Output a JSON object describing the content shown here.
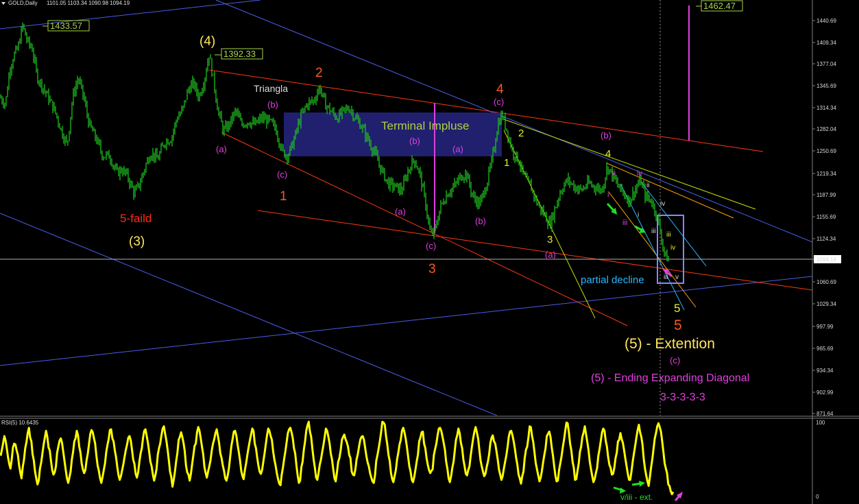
{
  "header": {
    "symbol": "GOLD,Daily",
    "ohlc": "1101.05 1103.34 1090.98 1094.19",
    "menu_icon": "triangle-down-icon"
  },
  "colors": {
    "background": "#000000",
    "candle": "#1fbf1f",
    "rsi": "#ffff00",
    "orange": "#ff5a1f",
    "yellow": "#ffe75a",
    "magenta": "#e040e0",
    "blue": "#4a5ee8",
    "cyan": "#2ab8ff",
    "green_arrow": "#22dd22",
    "box_blue": "#23237a",
    "price_box": "#a8d34a"
  },
  "chart_data": {
    "type": "candlestick",
    "title": "GOLD,Daily",
    "price_axis": {
      "ticks": [
        "1440.69",
        "1409.34",
        "1377.04",
        "1345.69",
        "1314.34",
        "1282.04",
        "1250.69",
        "1219.34",
        "1187.99",
        "1155.69",
        "1124.34",
        "1094.19",
        "1060.69",
        "1029.34",
        "997.99",
        "965.69",
        "934.34",
        "902.99",
        "871.64"
      ],
      "current": "1094.19",
      "ylim": [
        871.64,
        1462.47
      ]
    },
    "price_points": [
      {
        "x": 0,
        "y": 1330
      },
      {
        "x": 8,
        "y": 1320
      },
      {
        "x": 14,
        "y": 1370
      },
      {
        "x": 20,
        "y": 1390
      },
      {
        "x": 26,
        "y": 1400
      },
      {
        "x": 33,
        "y": 1433.57
      },
      {
        "x": 40,
        "y": 1410
      },
      {
        "x": 47,
        "y": 1400
      },
      {
        "x": 54,
        "y": 1360
      },
      {
        "x": 62,
        "y": 1345
      },
      {
        "x": 70,
        "y": 1330
      },
      {
        "x": 80,
        "y": 1310
      },
      {
        "x": 90,
        "y": 1280
      },
      {
        "x": 98,
        "y": 1260
      },
      {
        "x": 106,
        "y": 1330
      },
      {
        "x": 114,
        "y": 1358
      },
      {
        "x": 122,
        "y": 1330
      },
      {
        "x": 130,
        "y": 1290
      },
      {
        "x": 140,
        "y": 1270
      },
      {
        "x": 150,
        "y": 1245
      },
      {
        "x": 160,
        "y": 1245
      },
      {
        "x": 170,
        "y": 1220
      },
      {
        "x": 178,
        "y": 1225
      },
      {
        "x": 186,
        "y": 1215
      },
      {
        "x": 196,
        "y": 1190
      },
      {
        "x": 204,
        "y": 1205
      },
      {
        "x": 212,
        "y": 1230
      },
      {
        "x": 220,
        "y": 1250
      },
      {
        "x": 230,
        "y": 1240
      },
      {
        "x": 240,
        "y": 1265
      },
      {
        "x": 250,
        "y": 1270
      },
      {
        "x": 258,
        "y": 1300
      },
      {
        "x": 266,
        "y": 1310
      },
      {
        "x": 274,
        "y": 1340
      },
      {
        "x": 282,
        "y": 1350
      },
      {
        "x": 290,
        "y": 1330
      },
      {
        "x": 298,
        "y": 1355
      },
      {
        "x": 305,
        "y": 1392.33
      },
      {
        "x": 312,
        "y": 1350
      },
      {
        "x": 318,
        "y": 1310
      },
      {
        "x": 326,
        "y": 1280
      },
      {
        "x": 334,
        "y": 1290
      },
      {
        "x": 344,
        "y": 1310
      },
      {
        "x": 352,
        "y": 1290
      },
      {
        "x": 362,
        "y": 1295
      },
      {
        "x": 372,
        "y": 1290
      },
      {
        "x": 382,
        "y": 1300
      },
      {
        "x": 392,
        "y": 1295
      },
      {
        "x": 402,
        "y": 1285
      },
      {
        "x": 412,
        "y": 1250
      },
      {
        "x": 420,
        "y": 1245
      },
      {
        "x": 428,
        "y": 1265
      },
      {
        "x": 438,
        "y": 1300
      },
      {
        "x": 448,
        "y": 1320
      },
      {
        "x": 458,
        "y": 1325
      },
      {
        "x": 466,
        "y": 1345
      },
      {
        "x": 474,
        "y": 1320
      },
      {
        "x": 482,
        "y": 1310
      },
      {
        "x": 492,
        "y": 1300
      },
      {
        "x": 502,
        "y": 1310
      },
      {
        "x": 510,
        "y": 1315
      },
      {
        "x": 518,
        "y": 1300
      },
      {
        "x": 526,
        "y": 1290
      },
      {
        "x": 536,
        "y": 1270
      },
      {
        "x": 546,
        "y": 1250
      },
      {
        "x": 556,
        "y": 1225
      },
      {
        "x": 566,
        "y": 1205
      },
      {
        "x": 576,
        "y": 1200
      },
      {
        "x": 586,
        "y": 1195
      },
      {
        "x": 596,
        "y": 1225
      },
      {
        "x": 604,
        "y": 1240
      },
      {
        "x": 612,
        "y": 1220
      },
      {
        "x": 620,
        "y": 1180
      },
      {
        "x": 628,
        "y": 1130
      },
      {
        "x": 634,
        "y": 1135
      },
      {
        "x": 642,
        "y": 1170
      },
      {
        "x": 652,
        "y": 1190
      },
      {
        "x": 662,
        "y": 1200
      },
      {
        "x": 672,
        "y": 1215
      },
      {
        "x": 680,
        "y": 1220
      },
      {
        "x": 690,
        "y": 1185
      },
      {
        "x": 700,
        "y": 1175
      },
      {
        "x": 710,
        "y": 1205
      },
      {
        "x": 718,
        "y": 1240
      },
      {
        "x": 726,
        "y": 1290
      },
      {
        "x": 732,
        "y": 1305
      },
      {
        "x": 740,
        "y": 1280
      },
      {
        "x": 748,
        "y": 1250
      },
      {
        "x": 756,
        "y": 1240
      },
      {
        "x": 764,
        "y": 1215
      },
      {
        "x": 774,
        "y": 1200
      },
      {
        "x": 784,
        "y": 1175
      },
      {
        "x": 794,
        "y": 1160
      },
      {
        "x": 802,
        "y": 1145
      },
      {
        "x": 810,
        "y": 1170
      },
      {
        "x": 818,
        "y": 1195
      },
      {
        "x": 828,
        "y": 1210
      },
      {
        "x": 838,
        "y": 1200
      },
      {
        "x": 848,
        "y": 1195
      },
      {
        "x": 858,
        "y": 1205
      },
      {
        "x": 868,
        "y": 1200
      },
      {
        "x": 878,
        "y": 1195
      },
      {
        "x": 886,
        "y": 1230
      },
      {
        "x": 894,
        "y": 1215
      },
      {
        "x": 902,
        "y": 1200
      },
      {
        "x": 910,
        "y": 1190
      },
      {
        "x": 918,
        "y": 1180
      },
      {
        "x": 926,
        "y": 1195
      },
      {
        "x": 934,
        "y": 1210
      },
      {
        "x": 942,
        "y": 1185
      },
      {
        "x": 950,
        "y": 1180
      },
      {
        "x": 958,
        "y": 1160
      },
      {
        "x": 964,
        "y": 1130
      },
      {
        "x": 970,
        "y": 1100
      },
      {
        "x": 976,
        "y": 1094
      }
    ],
    "price_labels": [
      {
        "text": "1433.57",
        "x": 70,
        "y": 1433.57
      },
      {
        "text": "1392.33",
        "x": 325,
        "y": 1392.33
      },
      {
        "text": "1462.47",
        "x": 1023,
        "y": 1462.47
      }
    ],
    "rsi": {
      "label": "RSI(5) 10.6435",
      "ticks": [
        "100",
        "0"
      ],
      "ylim": [
        0,
        100
      ],
      "values": [
        54,
        62,
        71,
        80,
        74,
        63,
        52,
        43,
        37,
        49,
        65,
        70,
        69,
        61,
        55,
        41,
        32,
        24,
        39,
        49,
        64,
        72,
        84,
        91,
        78,
        73,
        56,
        48,
        33,
        24,
        16,
        21,
        37,
        45,
        57,
        69,
        78,
        87,
        79,
        65,
        61,
        47,
        35,
        29,
        32,
        40,
        58,
        66,
        74,
        77,
        71,
        59,
        47,
        35,
        24,
        18,
        25,
        33,
        49,
        59,
        73,
        77,
        87,
        81,
        66,
        58,
        44,
        36,
        31,
        35,
        48,
        57,
        70,
        83,
        88,
        85,
        77,
        70,
        54,
        41,
        34,
        24,
        18,
        26,
        35,
        44,
        59,
        68,
        76,
        88,
        89,
        77,
        73,
        61,
        52,
        39,
        28,
        22,
        27,
        35,
        43,
        53,
        62,
        69,
        78,
        80,
        74,
        62,
        49,
        43,
        30,
        25,
        32,
        46,
        57,
        64,
        78,
        87,
        89,
        80,
        71,
        59,
        46,
        40,
        29,
        21,
        28,
        36,
        55,
        64,
        70,
        81,
        90,
        93,
        83,
        74,
        62,
        48,
        33,
        26,
        13,
        22,
        33,
        47,
        58,
        75,
        79,
        85,
        79,
        71,
        60,
        41,
        32,
        29,
        21,
        30,
        43,
        55,
        67,
        70,
        85,
        92,
        87,
        77,
        66,
        56,
        39,
        31,
        25,
        33,
        40,
        48,
        61,
        70,
        76,
        84,
        89,
        80,
        71,
        57,
        51,
        41,
        34,
        24,
        21,
        28,
        38,
        53,
        67,
        76,
        86,
        87,
        81,
        69,
        59,
        48,
        34,
        27,
        23,
        35,
        44,
        55,
        65,
        74,
        82,
        90,
        87,
        70,
        64,
        52,
        41,
        33,
        30,
        35,
        46,
        57,
        69,
        81,
        90,
        87,
        80,
        75,
        60,
        49,
        41,
        31,
        23,
        17,
        15,
        29,
        38,
        50,
        60,
        72,
        84,
        89,
        91,
        85,
        77,
        64,
        57,
        41,
        28,
        18,
        21,
        39,
        46,
        62,
        73,
        87,
        94,
        99,
        86,
        79,
        63,
        49,
        38,
        25,
        22,
        31,
        42,
        49,
        59,
        68,
        79,
        90,
        87,
        79,
        70,
        57,
        49,
        36,
        24,
        20,
        32,
        46,
        51,
        61,
        75,
        79,
        82,
        76,
        72,
        66,
        55,
        51,
        33,
        29,
        28,
        36,
        49,
        56,
        66,
        75,
        79,
        80,
        75,
        64,
        53,
        45,
        40,
        31,
        25,
        20,
        18,
        28,
        47,
        55,
        64,
        74,
        85,
        99,
        98,
        95,
        80,
        69,
        55,
        47,
        31,
        23,
        19,
        27,
        35,
        49,
        58,
        69,
        75,
        87,
        91,
        85,
        77,
        66,
        53,
        40,
        33,
        22,
        19,
        26,
        36,
        47,
        55,
        73,
        78,
        85,
        86,
        70,
        64,
        51,
        42,
        35,
        31,
        34,
        36,
        55,
        63,
        70,
        81,
        90,
        91,
        87,
        79,
        71,
        62,
        46,
        37,
        24,
        19,
        27,
        38,
        46,
        61,
        75,
        81,
        90,
        84,
        71,
        64,
        49,
        40,
        30,
        28,
        35,
        40,
        54,
        66,
        77,
        86,
        92,
        85,
        77,
        62,
        48,
        40,
        33,
        27,
        30,
        39,
        46,
        56,
        71,
        78,
        81,
        73,
        70,
        60,
        49,
        36,
        29,
        22,
        27,
        37,
        46,
        54,
        65,
        79,
        86,
        87,
        81,
        73,
        63,
        51,
        42,
        29,
        24,
        17,
        27,
        33,
        51,
        62,
        66,
        78,
        93,
        92,
        80,
        72,
        58,
        44,
        36,
        28,
        20,
        25,
        34,
        45,
        55,
        64,
        80,
        83,
        86,
        79,
        65,
        54,
        40,
        28,
        20,
        21,
        35,
        44,
        53,
        65,
        75,
        87,
        98,
        97,
        85,
        70,
        61,
        46,
        38,
        22,
        23,
        34,
        44,
        59,
        66,
        79,
        85,
        93,
        82,
        72,
        61,
        46,
        36,
        27,
        19,
        23,
        31,
        38,
        54,
        63,
        74,
        85,
        90,
        87,
        74,
        66,
        52,
        42,
        38,
        29,
        30,
        38,
        51,
        58,
        73,
        75,
        84,
        76,
        71,
        61,
        50,
        40,
        30,
        22,
        22,
        33,
        46,
        57,
        67,
        78,
        88,
        95,
        85,
        79,
        69,
        50,
        37,
        28,
        20,
        14,
        26,
        39,
        50,
        64,
        77,
        84,
        93,
        97,
        92,
        86,
        73,
        59,
        44,
        37,
        31,
        16,
        14,
        7,
        3,
        6
      ]
    },
    "annotations": {
      "wave_4_paren": "(4)",
      "wave_3_paren": "(3)",
      "wave_5_paren_ext": "(5) -  Extention",
      "five_faild": "5-faild",
      "triangla": "Triangla",
      "terminal": "Terminal Impluse",
      "partial": "partial decline",
      "ending_diag": "(5) - Ending Expanding Diagonal",
      "count": "3-3-3-3-3",
      "rsi_note": "v/iii - ext.",
      "orange": {
        "one": "1",
        "two": "2",
        "three": "3",
        "four": "4",
        "five": "5"
      },
      "yellow": {
        "one": "1",
        "two": "2",
        "three": "3",
        "four": "4",
        "five": "5"
      },
      "magenta": {
        "a": "(a)",
        "b": "(b)",
        "c": "(c)"
      },
      "roman": {
        "i": "i",
        "ii": "ii",
        "iii": "iii",
        "iv": "iv",
        "v": "v"
      }
    }
  }
}
